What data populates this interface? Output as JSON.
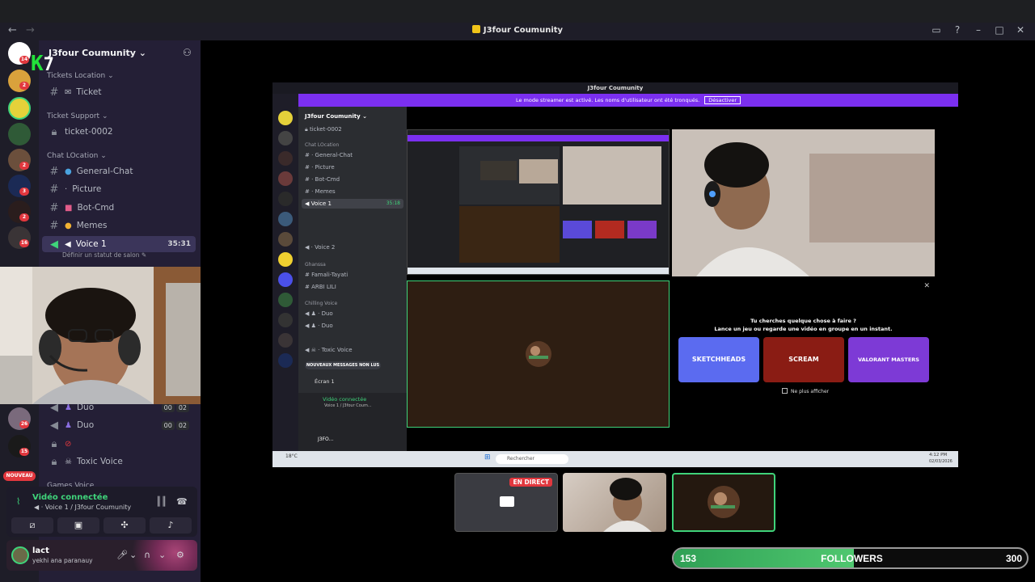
{
  "window": {
    "title": "J3four Coumunity",
    "nav_back": "←",
    "nav_forward": "→"
  },
  "server": {
    "name": "J3four Coumunity",
    "logo_text": "K",
    "logo_digit": "7"
  },
  "guild_badges": [
    "14",
    "2",
    "2",
    "3",
    "2",
    "16",
    "26",
    "15"
  ],
  "new_pill": "NOUVEAU",
  "sidebar": {
    "categories": {
      "tickets_location": "Tickets Location",
      "ticket_support": "Ticket Support",
      "chat_location": "Chat LOcation",
      "games_voice": "Games Voice"
    },
    "channels": {
      "ticket": "Ticket",
      "ticket_0002": "ticket-0002",
      "general_chat": "General-Chat",
      "picture": "Picture",
      "bot_cmd": "Bot-Cmd",
      "memes": "Memes",
      "voice1": "Voice 1",
      "voice1_timer": "35:31",
      "voice1_status": "Définir un statut de salon",
      "duo1": "Duo",
      "duo2": "Duo",
      "toxic_voice": "Toxic Voice",
      "duo_count_a": "00",
      "duo_count_b": "02"
    }
  },
  "voice_panel": {
    "title": "Vidéo connectée",
    "subtitle": "Voice 1 / J3four Coumunity"
  },
  "user_panel": {
    "name": "lact",
    "status": "yekhi ana paranauy"
  },
  "inner": {
    "title": "J3four Coumunity",
    "banner": "Le mode streamer est activé. Les noms d'utilisateur ont été tronqués.",
    "banner_button": "Désactiver",
    "server_name": "J3four Coumunity",
    "channels": [
      "ticket-0002",
      "Chat LOcation",
      "General-Chat",
      "Picture",
      "Bot-Cmd",
      "Memes",
      "Voice 1",
      "Voice 2",
      "Ghanssa",
      "Famali-Tayati",
      "ARBI LILI",
      "Chilling Voice",
      "Duo",
      "Duo",
      "Toxic Voice"
    ],
    "voice1_timer": "35:18",
    "new_messages": "NOUVEAUX MESSAGES NON LUS",
    "screen_label": "Écran 1",
    "video_connected": "Vidéo connectée",
    "video_sub": "Voice 1 / J3four Coum...",
    "user_short": "J3FO...",
    "activity_title": "Tu cherches quelque chose à faire ?",
    "activity_sub": "Lance un jeu ou regarde une vidéo en groupe en un instant.",
    "activity_tiles": [
      "SKETCHHEADS",
      "SCREAM",
      "VALORANT MASTERS"
    ],
    "dont_show": "Ne plus afficher",
    "taskbar_search": "Rechercher",
    "taskbar_time": "4:12 PM",
    "taskbar_date": "02/03/2026",
    "weather": "18°C"
  },
  "thumbs": {
    "live": "EN DIRECT"
  },
  "followers": {
    "current": "153",
    "label": "FOLLOWERS",
    "goal": "300",
    "progress": 0.51
  },
  "colors": {
    "accent_green": "#3fd37a",
    "live_red": "#e2373e",
    "banner_purple": "#7b2ff0",
    "logo_green": "#22e23a"
  }
}
